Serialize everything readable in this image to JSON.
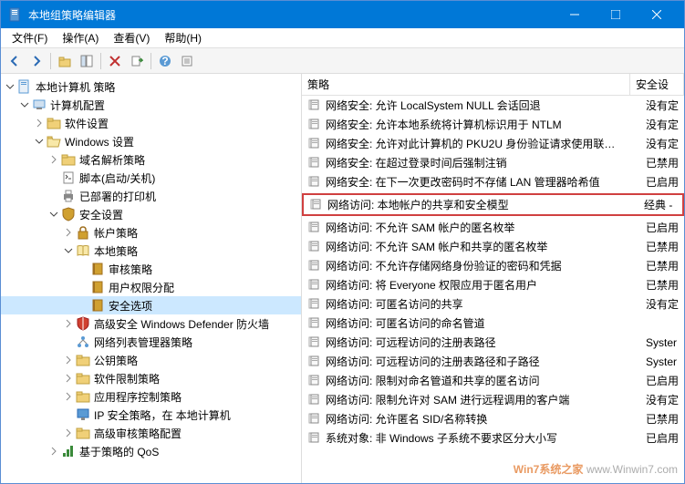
{
  "window": {
    "title": "本地组策略编辑器"
  },
  "menu": {
    "file": "文件(F)",
    "action": "操作(A)",
    "view": "查看(V)",
    "help": "帮助(H)"
  },
  "tree": {
    "root": "本地计算机 策略",
    "computer_config": "计算机配置",
    "software_settings": "软件设置",
    "windows_settings": "Windows 设置",
    "dns_policy": "域名解析策略",
    "scripts": "脚本(启动/关机)",
    "deployed_printers": "已部署的打印机",
    "security_settings": "安全设置",
    "account_policies": "帐户策略",
    "local_policies": "本地策略",
    "audit_policy": "审核策略",
    "user_rights": "用户权限分配",
    "security_options": "安全选项",
    "defender_firewall": "高级安全 Windows Defender 防火墙",
    "network_list": "网络列表管理器策略",
    "public_key": "公钥策略",
    "software_restriction": "软件限制策略",
    "app_control": "应用程序控制策略",
    "ip_security": "IP 安全策略，在 本地计算机",
    "advanced_audit": "高级审核策略配置",
    "qos": "基于策略的 QoS"
  },
  "list": {
    "header_policy": "策略",
    "header_security": "安全设",
    "rows": [
      {
        "t": "网络安全: 允许 LocalSystem NULL 会话回退",
        "s": "没有定"
      },
      {
        "t": "网络安全: 允许本地系统将计算机标识用于 NTLM",
        "s": "没有定"
      },
      {
        "t": "网络安全: 允许对此计算机的 PKU2U 身份验证请求使用联…",
        "s": "没有定"
      },
      {
        "t": "网络安全: 在超过登录时间后强制注销",
        "s": "已禁用"
      },
      {
        "t": "网络安全: 在下一次更改密码时不存储 LAN 管理器哈希值",
        "s": "已启用"
      },
      {
        "t": "网络访问: 本地帐户的共享和安全模型",
        "s": "经典 -",
        "hl": true
      },
      {
        "t": "网络访问: 不允许 SAM 帐户的匿名枚举",
        "s": "已启用"
      },
      {
        "t": "网络访问: 不允许 SAM 帐户和共享的匿名枚举",
        "s": "已禁用"
      },
      {
        "t": "网络访问: 不允许存储网络身份验证的密码和凭据",
        "s": "已禁用"
      },
      {
        "t": "网络访问: 将 Everyone 权限应用于匿名用户",
        "s": "已禁用"
      },
      {
        "t": "网络访问: 可匿名访问的共享",
        "s": "没有定"
      },
      {
        "t": "网络访问: 可匿名访问的命名管道",
        "s": ""
      },
      {
        "t": "网络访问: 可远程访问的注册表路径",
        "s": "Syster"
      },
      {
        "t": "网络访问: 可远程访问的注册表路径和子路径",
        "s": "Syster"
      },
      {
        "t": "网络访问: 限制对命名管道和共享的匿名访问",
        "s": "已启用"
      },
      {
        "t": "网络访问: 限制允许对 SAM 进行远程调用的客户端",
        "s": "没有定"
      },
      {
        "t": "网络访问: 允许匿名 SID/名称转换",
        "s": "已禁用"
      },
      {
        "t": "系统对象: 非 Windows 子系统不要求区分大小写",
        "s": "已启用"
      }
    ]
  },
  "watermark": {
    "brand": "Win7系统之家",
    "url": "www.Winwin7.com"
  }
}
